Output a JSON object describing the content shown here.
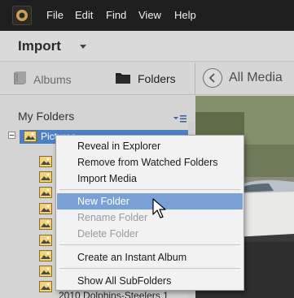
{
  "menubar": {
    "items": [
      "File",
      "Edit",
      "Find",
      "View",
      "Help"
    ]
  },
  "import_row": {
    "label": "Import"
  },
  "tabs": {
    "albums": "Albums",
    "folders": "Folders"
  },
  "media": {
    "title": "All Media"
  },
  "left_panel": {
    "heading": "My Folders",
    "selected_folder": "Pictures",
    "last_visible_folder": "2010 Dolphins-Steelers 1"
  },
  "context_menu": {
    "items": [
      {
        "label": "Reveal in Explorer",
        "enabled": true
      },
      {
        "label": "Remove from Watched Folders",
        "enabled": true
      },
      {
        "label": "Import Media",
        "enabled": true
      },
      {
        "label": "New Folder",
        "enabled": true,
        "highlighted": true
      },
      {
        "label": "Rename Folder",
        "enabled": false
      },
      {
        "label": "Delete Folder",
        "enabled": false
      },
      {
        "label": "Create an Instant Album",
        "enabled": true
      },
      {
        "label": "Show All SubFolders",
        "enabled": true
      }
    ]
  },
  "colors": {
    "menubar_bg": "#1f1f1f",
    "selection": "#4b80c6",
    "menu_highlight": "#7ba0d8"
  },
  "icons": [
    "app-logo-icon",
    "albums-icon",
    "folders-icon",
    "back-arrow-icon",
    "folder-options-icon",
    "image-folder-icon",
    "mouse-cursor-icon"
  ]
}
